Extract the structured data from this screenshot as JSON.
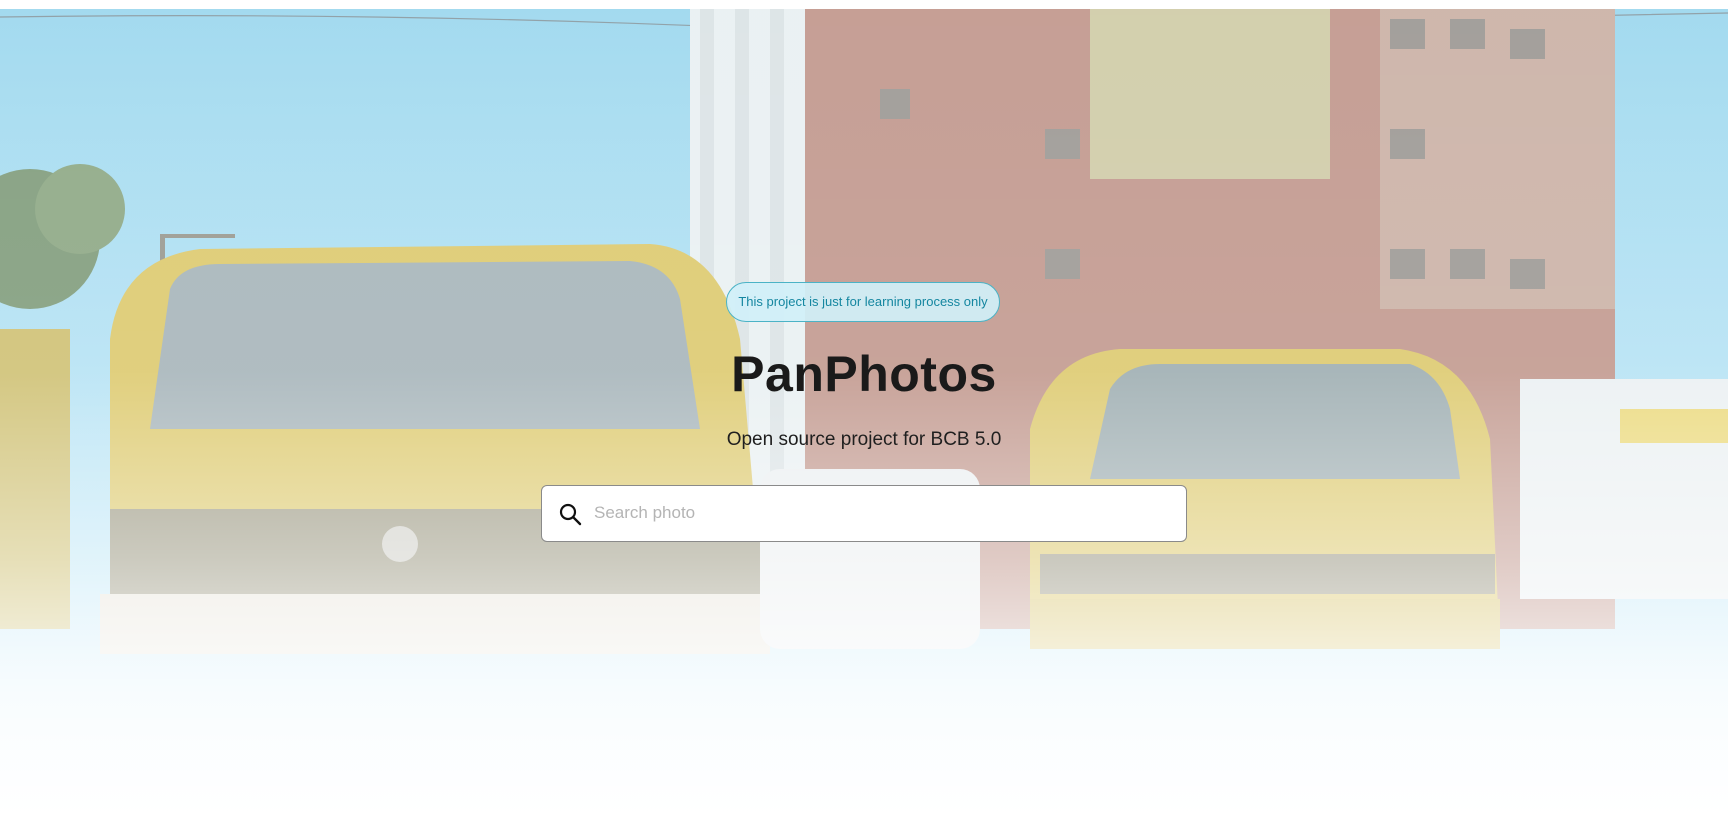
{
  "banner": {
    "badge_text": "This project is just for learning process only"
  },
  "hero": {
    "title": "PanPhotos",
    "subtitle": "Open source project for BCB 5.0",
    "background_description_icon": "photo-background"
  },
  "search": {
    "placeholder": "Search photo",
    "value": "",
    "icon": "search-icon"
  },
  "colors": {
    "badge_bg": "#d0f0f8",
    "badge_border": "#4bb3c6",
    "badge_text": "#1486a0",
    "title": "#1a1a1a"
  }
}
